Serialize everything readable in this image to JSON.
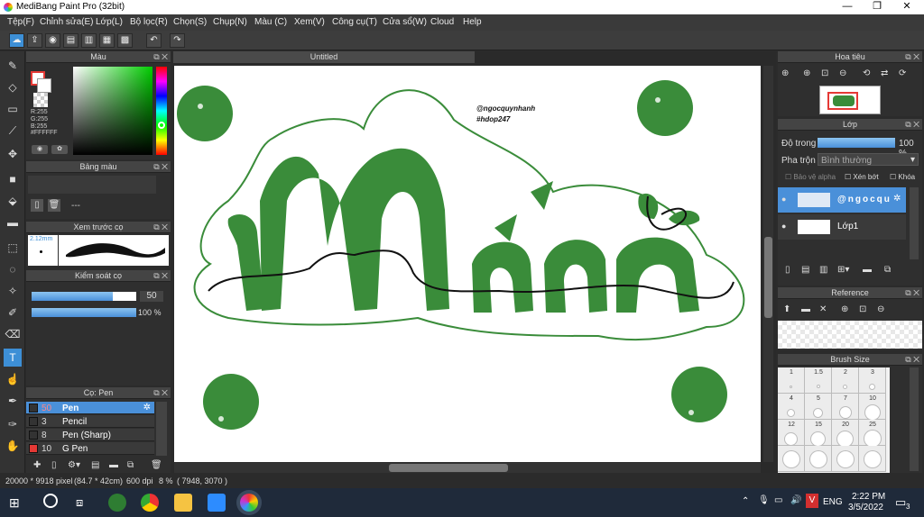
{
  "window": {
    "title": "MediBang Paint Pro (32bit)",
    "minimize": "—",
    "maximize": "❐",
    "close": "✕"
  },
  "menu": [
    "Tệp(F)",
    "Chỉnh sửa(E)",
    "Lớp(L)",
    "Bộ lọc(R)",
    "Chọn(S)",
    "Chụp(N)",
    "Màu (C)",
    "Xem(V)",
    "Công cụ(T)",
    "Cửa sổ(W)",
    "Cloud",
    "Help"
  ],
  "document": {
    "tab_title": "Untitled"
  },
  "color_panel": {
    "title": "Màu",
    "rgb_r": "R:255",
    "rgb_g": "G:255",
    "rgb_b": "B:255",
    "hex": "#FFFFFF",
    "foreground_color": "#ffffff",
    "accent": "#e53935"
  },
  "palette_panel": {
    "title": "Bảng màu",
    "empty_text": "---"
  },
  "preview_panel": {
    "title": "Xem trước cọ",
    "size_text": "2.12mm"
  },
  "brush_control": {
    "title": "Kiểm soát cọ",
    "size_value": "50",
    "opacity_value": "100 %",
    "size_fraction": 0.78,
    "opacity_fraction": 1.0
  },
  "brush_list": {
    "title": "Cọ: Pen",
    "items": [
      {
        "size": "50",
        "name": "Pen",
        "selected": true,
        "swatch": "#333333"
      },
      {
        "size": "3",
        "name": "Pencil",
        "selected": false,
        "swatch": "#333333"
      },
      {
        "size": "8",
        "name": "Pen (Sharp)",
        "selected": false,
        "swatch": "#333333"
      },
      {
        "size": "10",
        "name": "G Pen",
        "selected": false,
        "swatch": "#e53935"
      }
    ]
  },
  "navigator": {
    "title": "Hoa tiêu"
  },
  "layer_panel": {
    "title": "Lớp",
    "opacity_label": "Độ trong",
    "opacity_value": "100 %",
    "opacity_fraction": 1.0,
    "blend_label": "Pha trộn",
    "blend_value": "Bình thường",
    "protect_alpha": "Bảo vệ alpha",
    "clipping": "Xén bớt",
    "lock": "Khóa",
    "layers": [
      {
        "name": "@ngocqu",
        "selected": true
      },
      {
        "name": "Lớp1",
        "selected": false
      }
    ]
  },
  "reference_panel": {
    "title": "Reference"
  },
  "brush_size_panel": {
    "title": "Brush Size",
    "sizes": [
      "1",
      "1.5",
      "2",
      "3",
      "4",
      "5",
      "7",
      "10",
      "12",
      "15",
      "20",
      "25",
      "",
      "",
      "",
      ""
    ]
  },
  "artwork": {
    "watermark_line1": "@ngocquynhanh",
    "watermark_line2": "#hdop247",
    "green": "#3a8c3a"
  },
  "status": {
    "pixels": "20000 * 9918 pixel",
    "cm": "(84.7 * 42cm)",
    "dpi": "600 dpi",
    "zoom": "8 %",
    "coords": "( 7948, 3070 )"
  },
  "taskbar": {
    "time": "2:22 PM",
    "date": "3/5/2022",
    "lang": "ENG",
    "notifications": "3"
  }
}
